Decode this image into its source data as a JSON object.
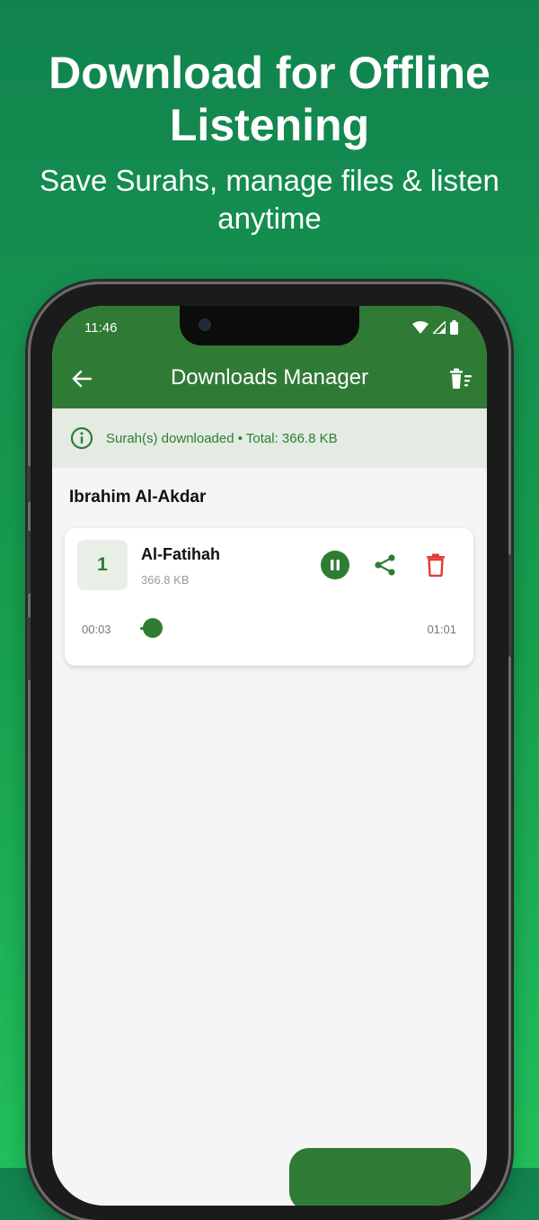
{
  "promo": {
    "title": "Download for Offline Listening",
    "subtitle": "Save Surahs, manage files & listen anytime"
  },
  "status_bar": {
    "time": "11:46",
    "icons": [
      "wifi-icon",
      "signal-icon",
      "battery-icon"
    ]
  },
  "toolbar": {
    "title": "Downloads Manager",
    "back_icon": "arrow-left-icon",
    "action_icon": "delete-sweep-icon"
  },
  "info_banner": {
    "icon": "info-icon",
    "text": "Surah(s) downloaded • Total: 366.8 KB"
  },
  "reciter": {
    "name": "Ibrahim Al-Akdar"
  },
  "downloads": [
    {
      "number": "1",
      "name": "Al-Fatihah",
      "size": "366.8 KB",
      "current_time": "00:03",
      "total_time": "01:01",
      "progress": 0.05,
      "playing": true
    }
  ],
  "colors": {
    "primary": "#2f7b35",
    "accent_text": "#2e7d32",
    "delete_red": "#e53935",
    "banner_bg": "#e3ebe3"
  }
}
